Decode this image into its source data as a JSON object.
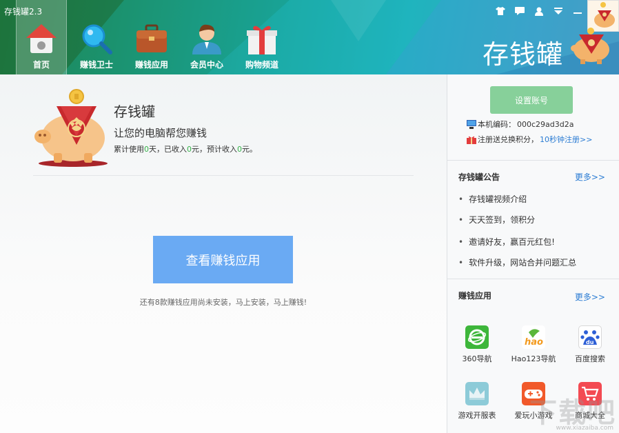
{
  "app": {
    "title": "存钱罐2.3"
  },
  "nav": [
    {
      "label": "首页",
      "icon": "home-icon"
    },
    {
      "label": "赚钱卫士",
      "icon": "magnifier-icon"
    },
    {
      "label": "赚钱应用",
      "icon": "briefcase-icon"
    },
    {
      "label": "会员中心",
      "icon": "member-icon"
    },
    {
      "label": "购物频道",
      "icon": "gift-icon"
    }
  ],
  "window_controls": [
    "shirt-icon",
    "message-icon",
    "user-icon",
    "menu-icon",
    "minimize-icon"
  ],
  "brand": {
    "text": "存钱罐"
  },
  "hero": {
    "title": "存钱罐",
    "subtitle": "让您的电脑帮您赚钱",
    "stats": {
      "prefix": "累计使用",
      "days": "0",
      "days_unit": "天，已收入",
      "income": "0",
      "income_unit": "元，预计收入",
      "expected": "0",
      "expected_unit": "元。"
    }
  },
  "main": {
    "button_label": "查看赚钱应用",
    "hint": "还有8款赚钱应用尚未安装，马上安装，马上赚钱!"
  },
  "sidebar": {
    "setup_button": "设置账号",
    "machine_label": "本机编码：",
    "machine_code": "000c29ad3d2a",
    "register_text": "注册送兑换积分，",
    "register_link": "10秒钟注册>>",
    "notices_title": "存钱罐公告",
    "notices_more": "更多>>",
    "notices": [
      "存钱罐视频介绍",
      "天天签到，领积分",
      "邀请好友，赢百元红包!",
      "软件升级，网站合并问题汇总"
    ],
    "apps_title": "赚钱应用",
    "apps_more": "更多>>",
    "apps": [
      {
        "label": "360导航",
        "icon_text": "e",
        "color": "#3db63a"
      },
      {
        "label": "Hao123导航",
        "icon_text": "hao",
        "color": "#ffffff"
      },
      {
        "label": "百度搜索",
        "icon_text": "du",
        "color": "#2d5fd6"
      },
      {
        "label": "游戏开服表",
        "icon_text": "♛",
        "color": "#7fc6d6"
      },
      {
        "label": "爱玩小游戏",
        "icon_text": "◎",
        "color": "#f1592a"
      },
      {
        "label": "商城大全",
        "icon_text": "🛒",
        "color": "#f34a52"
      }
    ]
  },
  "watermark": {
    "text": "下载吧",
    "url": "www.xiazaiba.com"
  }
}
